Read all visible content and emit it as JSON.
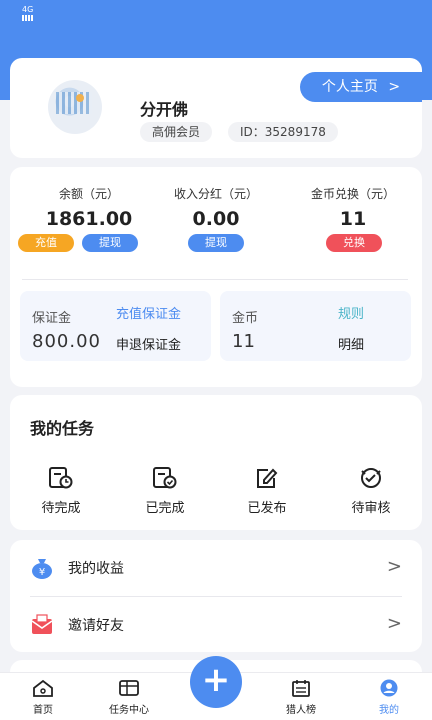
{
  "status_bar": {
    "signal": "4G"
  },
  "profile": {
    "name": "分开佛",
    "membership": "高佣会员",
    "id_label": "ID：",
    "id_value": "35289178",
    "home_button": "个人主页",
    "home_chevron": ">"
  },
  "balance": {
    "items": [
      {
        "label": "余额（元）",
        "value": "1861.00"
      },
      {
        "label": "收入分红（元）",
        "value": "0.00"
      },
      {
        "label": "金币兑换（元）",
        "value": "11"
      }
    ],
    "buttons": {
      "recharge": "充值",
      "withdraw1": "提现",
      "withdraw2": "提现",
      "exchange": "兑换"
    },
    "deposit": {
      "label": "保证金",
      "action": "充值保证金",
      "amount": "800.00",
      "refund": "申退保证金"
    },
    "coins": {
      "label": "金币",
      "action": "规则",
      "amount": "11",
      "detail": "明细"
    }
  },
  "tasks": {
    "title": "我的任务",
    "items": [
      {
        "label": "待完成",
        "icon": "clock-doc-icon"
      },
      {
        "label": "已完成",
        "icon": "check-doc-icon"
      },
      {
        "label": "已发布",
        "icon": "edit-icon"
      },
      {
        "label": "待审核",
        "icon": "review-icon"
      }
    ]
  },
  "menu": {
    "earnings": "我的收益",
    "invite": "邀请好友",
    "chevron": ">"
  },
  "tabbar": {
    "items": [
      {
        "label": "首页"
      },
      {
        "label": "任务中心"
      },
      {
        "label": "猎人榜"
      },
      {
        "label": "我的"
      }
    ],
    "plus": "+"
  },
  "colors": {
    "primary": "#4d8cf0",
    "orange": "#f6a623",
    "red": "#f0515a"
  }
}
